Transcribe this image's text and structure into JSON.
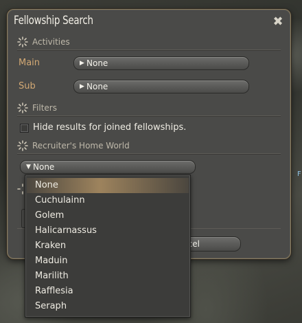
{
  "window": {
    "title": "Fellowship Search",
    "close_icon": "close-cross-icon"
  },
  "sections": {
    "activities": "Activities",
    "filters": "Filters",
    "home_world": "Recruiter's Home World"
  },
  "activities": {
    "main_label": "Main",
    "main_value": "None",
    "sub_label": "Sub",
    "sub_value": "None"
  },
  "filters": {
    "hide_joined_label": "Hide results for joined fellowships.",
    "hide_joined_checked": false
  },
  "home_world": {
    "selected": "None",
    "options": [
      "None",
      "Cuchulainn",
      "Golem",
      "Halicarnassus",
      "Kraken",
      "Maduin",
      "Marilith",
      "Rafflesia",
      "Seraph"
    ]
  },
  "footer": {
    "cancel_label": "Cancel",
    "cancel_visible_label": "ncel"
  },
  "colors": {
    "window_bg": "#4a4a48",
    "accent_label": "#d3a974",
    "text": "#efece3",
    "selection": "#be9b69"
  }
}
